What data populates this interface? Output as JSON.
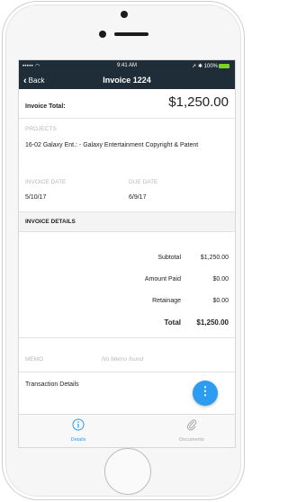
{
  "statusbar": {
    "carrier": "••••• ",
    "time": "9:41 AM",
    "battery": "100%"
  },
  "navbar": {
    "back_label": "Back",
    "title": "Invoice  1224"
  },
  "invoice": {
    "total_label": "Invoice Total:",
    "total_value": "$1,250.00",
    "projects_label": "PROJECTS",
    "projects_value": "16-02 Galaxy Ent.: - Galaxy Entertainment Copyright & Patent",
    "invoice_date_label": "INVOICE DATE",
    "invoice_date_value": "5/10/17",
    "due_date_label": "DUE DATE",
    "due_date_value": "6/9/17"
  },
  "details": {
    "header": "INVOICE DETAILS",
    "rows": [
      {
        "label": "Subtotal",
        "value": "$1,250.00"
      },
      {
        "label": "Amount Paid",
        "value": "$0.00"
      },
      {
        "label": "Retainage",
        "value": "$0.00"
      }
    ],
    "total_label": "Total",
    "total_value": "$1,250.00"
  },
  "memo": {
    "label": "MEMO",
    "value": "No Memo found"
  },
  "transaction": {
    "label": "Transaction Details"
  },
  "tabs": [
    {
      "label": "Details",
      "icon": "info-icon",
      "active": true
    },
    {
      "label": "Documents",
      "icon": "paperclip-icon",
      "active": false
    }
  ],
  "colors": {
    "navbar": "#1f2d39",
    "accent": "#2b9cf2",
    "battery": "#7ed321"
  }
}
